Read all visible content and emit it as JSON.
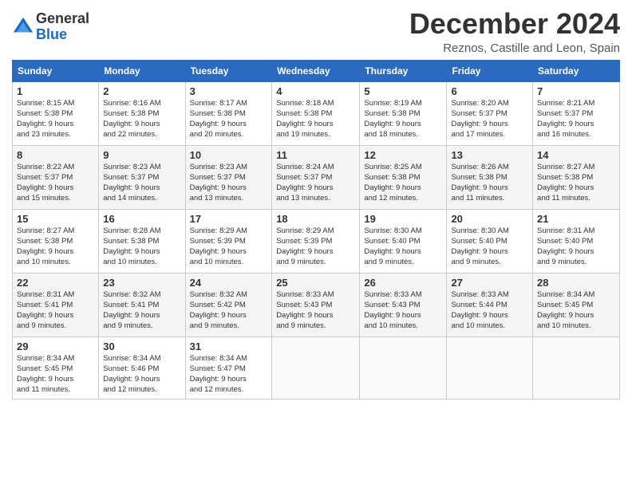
{
  "header": {
    "logo_general": "General",
    "logo_blue": "Blue",
    "title": "December 2024",
    "location": "Reznos, Castille and Leon, Spain"
  },
  "weekdays": [
    "Sunday",
    "Monday",
    "Tuesday",
    "Wednesday",
    "Thursday",
    "Friday",
    "Saturday"
  ],
  "weeks": [
    [
      {
        "day": "1",
        "info": "Sunrise: 8:15 AM\nSunset: 5:38 PM\nDaylight: 9 hours\nand 23 minutes."
      },
      {
        "day": "2",
        "info": "Sunrise: 8:16 AM\nSunset: 5:38 PM\nDaylight: 9 hours\nand 22 minutes."
      },
      {
        "day": "3",
        "info": "Sunrise: 8:17 AM\nSunset: 5:38 PM\nDaylight: 9 hours\nand 20 minutes."
      },
      {
        "day": "4",
        "info": "Sunrise: 8:18 AM\nSunset: 5:38 PM\nDaylight: 9 hours\nand 19 minutes."
      },
      {
        "day": "5",
        "info": "Sunrise: 8:19 AM\nSunset: 5:38 PM\nDaylight: 9 hours\nand 18 minutes."
      },
      {
        "day": "6",
        "info": "Sunrise: 8:20 AM\nSunset: 5:37 PM\nDaylight: 9 hours\nand 17 minutes."
      },
      {
        "day": "7",
        "info": "Sunrise: 8:21 AM\nSunset: 5:37 PM\nDaylight: 9 hours\nand 16 minutes."
      }
    ],
    [
      {
        "day": "8",
        "info": "Sunrise: 8:22 AM\nSunset: 5:37 PM\nDaylight: 9 hours\nand 15 minutes."
      },
      {
        "day": "9",
        "info": "Sunrise: 8:23 AM\nSunset: 5:37 PM\nDaylight: 9 hours\nand 14 minutes."
      },
      {
        "day": "10",
        "info": "Sunrise: 8:23 AM\nSunset: 5:37 PM\nDaylight: 9 hours\nand 13 minutes."
      },
      {
        "day": "11",
        "info": "Sunrise: 8:24 AM\nSunset: 5:37 PM\nDaylight: 9 hours\nand 13 minutes."
      },
      {
        "day": "12",
        "info": "Sunrise: 8:25 AM\nSunset: 5:38 PM\nDaylight: 9 hours\nand 12 minutes."
      },
      {
        "day": "13",
        "info": "Sunrise: 8:26 AM\nSunset: 5:38 PM\nDaylight: 9 hours\nand 11 minutes."
      },
      {
        "day": "14",
        "info": "Sunrise: 8:27 AM\nSunset: 5:38 PM\nDaylight: 9 hours\nand 11 minutes."
      }
    ],
    [
      {
        "day": "15",
        "info": "Sunrise: 8:27 AM\nSunset: 5:38 PM\nDaylight: 9 hours\nand 10 minutes."
      },
      {
        "day": "16",
        "info": "Sunrise: 8:28 AM\nSunset: 5:38 PM\nDaylight: 9 hours\nand 10 minutes."
      },
      {
        "day": "17",
        "info": "Sunrise: 8:29 AM\nSunset: 5:39 PM\nDaylight: 9 hours\nand 10 minutes."
      },
      {
        "day": "18",
        "info": "Sunrise: 8:29 AM\nSunset: 5:39 PM\nDaylight: 9 hours\nand 9 minutes."
      },
      {
        "day": "19",
        "info": "Sunrise: 8:30 AM\nSunset: 5:40 PM\nDaylight: 9 hours\nand 9 minutes."
      },
      {
        "day": "20",
        "info": "Sunrise: 8:30 AM\nSunset: 5:40 PM\nDaylight: 9 hours\nand 9 minutes."
      },
      {
        "day": "21",
        "info": "Sunrise: 8:31 AM\nSunset: 5:40 PM\nDaylight: 9 hours\nand 9 minutes."
      }
    ],
    [
      {
        "day": "22",
        "info": "Sunrise: 8:31 AM\nSunset: 5:41 PM\nDaylight: 9 hours\nand 9 minutes."
      },
      {
        "day": "23",
        "info": "Sunrise: 8:32 AM\nSunset: 5:41 PM\nDaylight: 9 hours\nand 9 minutes."
      },
      {
        "day": "24",
        "info": "Sunrise: 8:32 AM\nSunset: 5:42 PM\nDaylight: 9 hours\nand 9 minutes."
      },
      {
        "day": "25",
        "info": "Sunrise: 8:33 AM\nSunset: 5:43 PM\nDaylight: 9 hours\nand 9 minutes."
      },
      {
        "day": "26",
        "info": "Sunrise: 8:33 AM\nSunset: 5:43 PM\nDaylight: 9 hours\nand 10 minutes."
      },
      {
        "day": "27",
        "info": "Sunrise: 8:33 AM\nSunset: 5:44 PM\nDaylight: 9 hours\nand 10 minutes."
      },
      {
        "day": "28",
        "info": "Sunrise: 8:34 AM\nSunset: 5:45 PM\nDaylight: 9 hours\nand 10 minutes."
      }
    ],
    [
      {
        "day": "29",
        "info": "Sunrise: 8:34 AM\nSunset: 5:45 PM\nDaylight: 9 hours\nand 11 minutes."
      },
      {
        "day": "30",
        "info": "Sunrise: 8:34 AM\nSunset: 5:46 PM\nDaylight: 9 hours\nand 12 minutes."
      },
      {
        "day": "31",
        "info": "Sunrise: 8:34 AM\nSunset: 5:47 PM\nDaylight: 9 hours\nand 12 minutes."
      },
      {
        "day": "",
        "info": ""
      },
      {
        "day": "",
        "info": ""
      },
      {
        "day": "",
        "info": ""
      },
      {
        "day": "",
        "info": ""
      }
    ]
  ]
}
